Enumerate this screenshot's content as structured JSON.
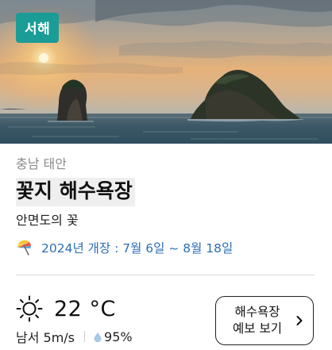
{
  "hero": {
    "image_alt": "서해 바다 위 두 개의 바위섬과 석양"
  },
  "badge": "서해",
  "location": {
    "region": "충남 태안",
    "name": "꽃지 해수욕장",
    "description": "안면도의 꽃"
  },
  "opening": {
    "text": "2024년 개장 : 7월 6일 ~ 8월 18일",
    "icon": "beach-umbrella-icon"
  },
  "weather": {
    "icon": "sun-icon",
    "temperature": "22 °C",
    "wind": "남서 5m/s",
    "humidity": "95%",
    "humidity_icon": "water-drop-icon"
  },
  "forecast_button": {
    "line1": "해수욕장",
    "line2": "예보 보기",
    "icon": "chevron-right-icon"
  },
  "colors": {
    "badge": "#1b9c96",
    "opening_text": "#2c6fb7",
    "region_text": "#8a8a8a"
  }
}
